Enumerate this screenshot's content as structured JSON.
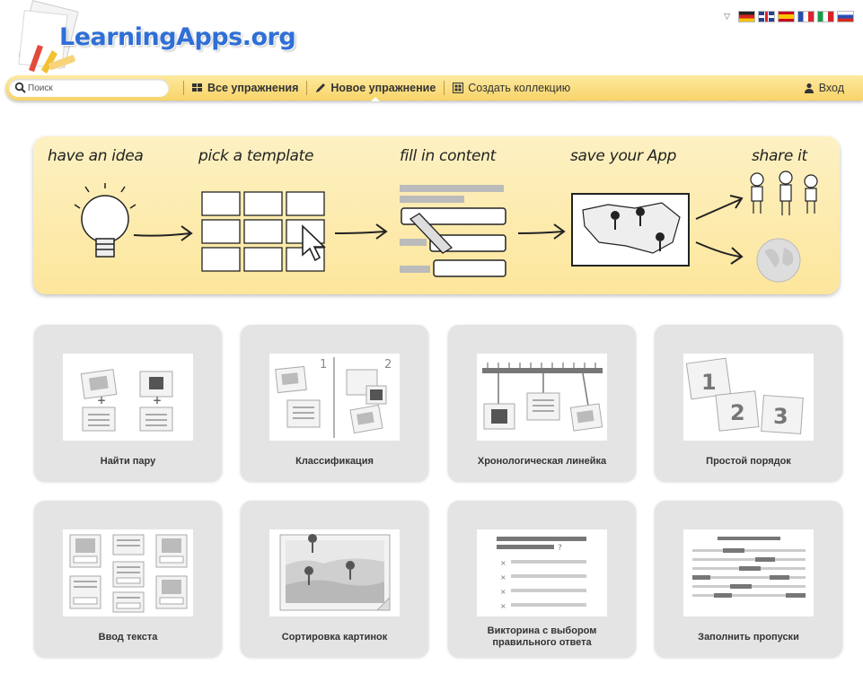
{
  "header": {
    "logo_text": "LearningApps.org"
  },
  "languages": [
    "de",
    "en",
    "es",
    "fr",
    "it",
    "ru"
  ],
  "nav": {
    "search_placeholder": "Поиск",
    "all_exercises": "Все упражнения",
    "new_exercise": "Новое упражнение",
    "create_collection": "Создать коллекцию",
    "login": "Вход"
  },
  "banner": {
    "steps": [
      "have an idea",
      "pick a template",
      "fill in content",
      "save your App",
      "share it"
    ]
  },
  "templates": [
    {
      "label": "Найти пару",
      "icon": "matching-pairs-icon"
    },
    {
      "label": "Классификация",
      "icon": "group-assignment-icon"
    },
    {
      "label": "Хронологическая линейка",
      "icon": "timeline-icon"
    },
    {
      "label": "Простой порядок",
      "icon": "simple-order-icon"
    },
    {
      "label": "Ввод текста",
      "icon": "text-input-icon"
    },
    {
      "label": "Сортировка картинок",
      "icon": "image-sorting-icon"
    },
    {
      "label": "Викторина с выбором правильного ответа",
      "icon": "multiple-choice-icon"
    },
    {
      "label": "Заполнить пропуски",
      "icon": "fill-blanks-icon"
    }
  ],
  "colors": {
    "brand_blue": "#2f6fd6",
    "navbar_yellow": "#f8d468",
    "banner_yellow": "#fde69c",
    "tile_gray": "#e4e4e4"
  }
}
